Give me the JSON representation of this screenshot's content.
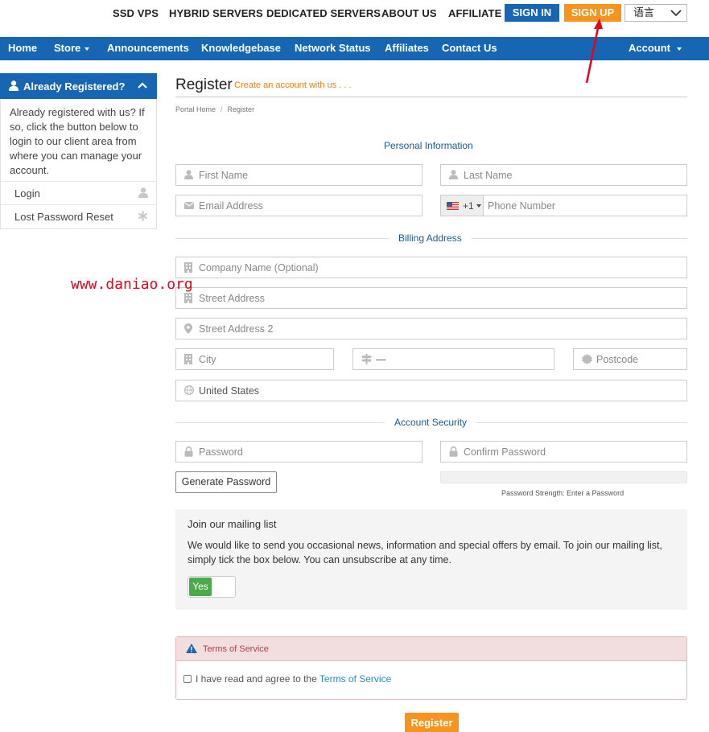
{
  "topbar": {
    "links": [
      "SSD VPS",
      "HYBRID SERVERS",
      "DEDICATED SERVERS",
      "ABOUT US",
      "AFFILIATE"
    ],
    "sign_in": "SIGN IN",
    "sign_up": "SIGN UP",
    "language": "语言"
  },
  "nav": {
    "home": "Home",
    "store": "Store",
    "announcements": "Announcements",
    "knowledgebase": "Knowledgebase",
    "network_status": "Network Status",
    "affiliates": "Affiliates",
    "contact_us": "Contact Us",
    "account": "Account"
  },
  "sidebar": {
    "title": "Already Registered?",
    "text": "Already registered with us? If so, click the button below to login to our client area from where you can manage your account.",
    "items": [
      {
        "label": "Login",
        "icon": "user-icon"
      },
      {
        "label": "Lost Password Reset",
        "icon": "asterisk-icon"
      }
    ]
  },
  "page": {
    "title": "Register",
    "subtitle": "Create an account with us . . .",
    "breadcrumb": [
      "Portal Home",
      "Register"
    ],
    "breadcrumb_sep": "/"
  },
  "sections": {
    "personal": "Personal Information",
    "billing": "Billing Address",
    "security": "Account Security"
  },
  "fields": {
    "first_name": "First Name",
    "last_name": "Last Name",
    "email": "Email Address",
    "phone_code": "+1",
    "phone": "Phone Number",
    "company": "Company Name (Optional)",
    "street": "Street Address",
    "street2": "Street Address 2",
    "city": "City",
    "state": "—",
    "postcode": "Postcode",
    "country": "United States",
    "password": "Password",
    "confirm_password": "Confirm Password"
  },
  "security": {
    "generate_button": "Generate Password",
    "strength_text": "Password Strength: Enter a Password"
  },
  "mailing": {
    "title": "Join our mailing list",
    "description": "We would like to send you occasional news, information and special offers by email. To join our mailing list, simply tick the box below. You can unsubscribe at any time.",
    "toggle_label": "Yes"
  },
  "tos": {
    "title": "Terms of Service",
    "text": "I have read and agree to the ",
    "link": "Terms of Service"
  },
  "register_button": "Register",
  "watermark": "www.daniao.org",
  "colors": {
    "brand_blue": "#1766b4",
    "accent_orange": "#f7941d",
    "toggle_green": "#4caa4a",
    "annotation_red": "#e8001c"
  }
}
